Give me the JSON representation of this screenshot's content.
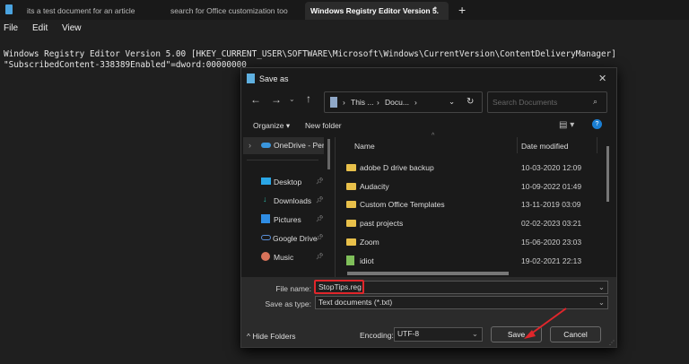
{
  "tabs": [
    {
      "label": "its a test document for an article"
    },
    {
      "label": "search for Office customization too"
    },
    {
      "label": "Windows Registry Editor Version 5."
    }
  ],
  "new_tab": "+",
  "modified_dot": "●",
  "menu": [
    "File",
    "Edit",
    "View"
  ],
  "editor": {
    "lines": [
      "Windows Registry Editor Version 5.00 [HKEY_CURRENT_USER\\SOFTWARE\\Microsoft\\Windows\\CurrentVersion\\ContentDeliveryManager]",
      "\"SubscribedContent-338389Enabled\"=dword:00000000"
    ]
  },
  "dialog": {
    "title": "Save as",
    "close": "✕",
    "address": [
      "This ...",
      "Docu..."
    ],
    "search_placeholder": "Search Documents",
    "organize": "Organize ▾",
    "new_folder": "New folder",
    "nav": [
      {
        "label": "OneDrive - Perso",
        "icon": "cloud-icon"
      },
      {
        "label": "Desktop",
        "icon": "desktop-icon"
      },
      {
        "label": "Downloads",
        "icon": "download-icon"
      },
      {
        "label": "Pictures",
        "icon": "pictures-icon"
      },
      {
        "label": "Google Drive",
        "icon": "cloud-outline-icon"
      },
      {
        "label": "Music",
        "icon": "music-icon"
      }
    ],
    "columns": {
      "name": "Name",
      "date": "Date modified"
    },
    "files": [
      {
        "name": "adobe D drive backup",
        "date": "10-03-2020 12:09",
        "type": "folder"
      },
      {
        "name": "Audacity",
        "date": "10-09-2022 01:49",
        "type": "folder"
      },
      {
        "name": "Custom Office Templates",
        "date": "13-11-2019 03:09",
        "type": "folder"
      },
      {
        "name": "past projects",
        "date": "02-02-2023 03:21",
        "type": "folder"
      },
      {
        "name": "Zoom",
        "date": "15-06-2020 23:03",
        "type": "folder"
      },
      {
        "name": "idiot",
        "date": "19-02-2021 22:13",
        "type": "file"
      }
    ],
    "file_name_label": "File name:",
    "file_name": "StopTips.reg",
    "type_label": "Save as type:",
    "type_value": "Text documents (*.txt)",
    "hide_folders": "Hide Folders",
    "encoding_label": "Encoding:",
    "encoding_value": "UTF-8",
    "save": "Save",
    "cancel": "Cancel"
  },
  "colors": {
    "annotation": "#e0262b",
    "folder": "#e8c04a",
    "help": "#1a7fd4"
  }
}
